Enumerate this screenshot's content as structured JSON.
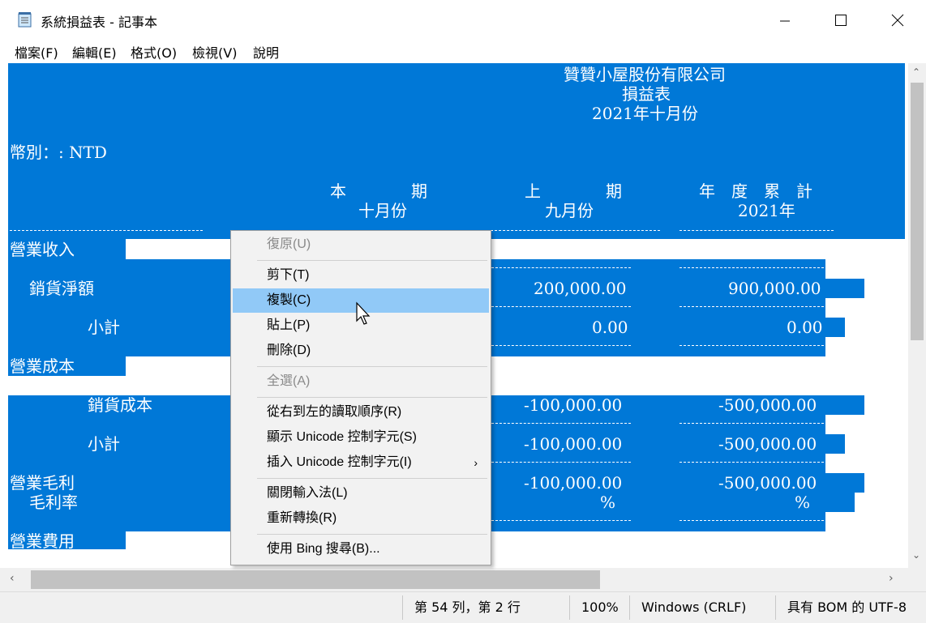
{
  "window": {
    "title": "系統損益表 - 記事本"
  },
  "menu": [
    "檔案(F)",
    "編輯(E)",
    "格式(O)",
    "檢視(V)",
    "說明"
  ],
  "document": {
    "company": "贊贊小屋股份有限公司",
    "report": "損益表",
    "period": "2021年十月份",
    "currency": "幣別：: NTD",
    "col_headers": {
      "current": "本　　　　期",
      "previous": "上　　　　期",
      "ytd": "年　度　累　計",
      "current_sub": "十月份",
      "previous_sub": "九月份",
      "ytd_sub": "2021年"
    },
    "rows": {
      "revenue": "營業收入",
      "net_sales": "銷貨淨額",
      "net_sales_prev": "200,000.00",
      "net_sales_ytd": "900,000.00",
      "subtotal1": "小計",
      "subtotal1_prev": "0.00",
      "subtotal1_ytd": "0.00",
      "cost": "營業成本",
      "cogs": "銷貨成本",
      "cogs_prev": "-100,000.00",
      "cogs_ytd": "-500,000.00",
      "subtotal2": "小計",
      "subtotal2_prev": "-100,000.00",
      "subtotal2_ytd": "-500,000.00",
      "gross_profit": "營業毛利",
      "gross_profit_prev": "-100,000.00",
      "gross_profit_ytd": "-500,000.00",
      "gross_margin": "毛利率",
      "pct": "%",
      "expenses": "營業費用"
    }
  },
  "context_menu": {
    "undo": "復原(U)",
    "cut": "剪下(T)",
    "copy": "複製(C)",
    "paste": "貼上(P)",
    "delete": "刪除(D)",
    "select_all": "全選(A)",
    "rtl": "從右到左的讀取順序(R)",
    "show_unicode": "顯示 Unicode 控制字元(S)",
    "insert_unicode": "插入 Unicode 控制字元(I)",
    "close_ime": "關閉輸入法(L)",
    "reconvert": "重新轉換(R)",
    "bing": "使用 Bing 搜尋(B)..."
  },
  "status": {
    "position": "第 54 列，第 2 行",
    "zoom": "100%",
    "line_ending": "Windows (CRLF)",
    "encoding": "具有 BOM 的 UTF-8"
  },
  "colors": {
    "selection": "#0078d7",
    "menu_hover": "#91c9f7"
  }
}
